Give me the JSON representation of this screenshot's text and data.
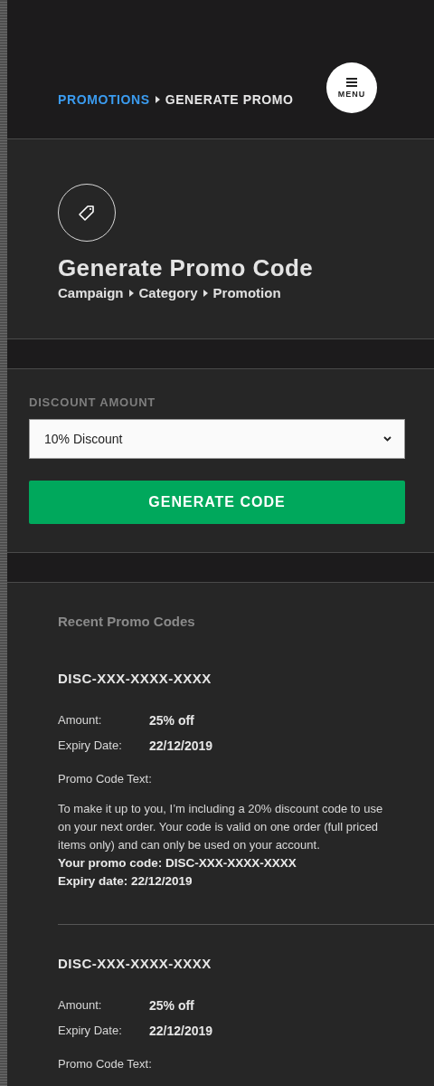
{
  "breadcrumb": [
    {
      "label": "PROMOTIONS",
      "selected": false
    },
    {
      "label": "GENERATE PROMO",
      "selected": true
    }
  ],
  "menu_button": {
    "label": "MENU"
  },
  "hero": {
    "title": "Generate Promo Code",
    "steps": [
      "Campaign",
      "Category",
      "Promotion"
    ]
  },
  "form": {
    "label": "DISCOUNT AMOUNT",
    "select_value": "10% Discount",
    "button": "GENERATE CODE"
  },
  "recent": {
    "title": "Recent Promo Codes",
    "codes": [
      {
        "code": "DISC-XXX-XXXX-XXXX",
        "fields": [
          {
            "label": "Amount:",
            "value": "25% off"
          },
          {
            "label": "Expiry Date:",
            "value": "22/12/2019"
          }
        ],
        "text_label": "Promo Code Text:",
        "text": "To make it up to you, I’m including a 20% discount code to use on your next order. Your code is valid on one order (full priced items only) and can only be used on your account.\n**Your promo code: DISC-XXX-XXXX-XXXX**\n**Expiry date: 22/12/2019**"
      },
      {
        "code": "DISC-XXX-XXXX-XXXX",
        "fields": [
          {
            "label": "Amount:",
            "value": "25% off"
          },
          {
            "label": "Expiry Date:",
            "value": "22/12/2019"
          }
        ],
        "text_label": "Promo Code Text:"
      }
    ]
  }
}
